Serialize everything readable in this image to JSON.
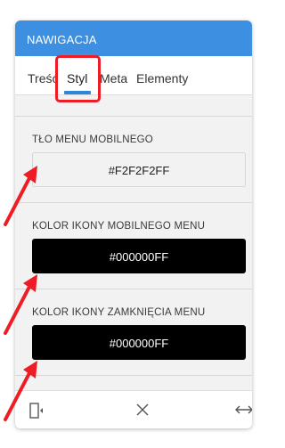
{
  "panel": {
    "title": "NAWIGACJA"
  },
  "tabs": [
    {
      "label": "Treść"
    },
    {
      "label": "Styl",
      "active": true
    },
    {
      "label": "Meta"
    },
    {
      "label": "Elementy"
    }
  ],
  "sections": [
    {
      "label": "TŁO MENU MOBILNEGO",
      "value": "#F2F2F2FF",
      "color": "#f2f2f2"
    },
    {
      "label": "KOLOR IKONY MOBILNEGO MENU",
      "value": "#000000FF",
      "color": "#000000"
    },
    {
      "label": "KOLOR IKONY ZAMKNIĘCIA MENU",
      "value": "#000000FF",
      "color": "#000000"
    }
  ],
  "footer": {
    "icons": [
      "mobile-preview-icon",
      "close-icon",
      "horizontal-resize-icon"
    ]
  },
  "colors": {
    "header": "#3d8fe2",
    "accent": "#2f86d9",
    "annotation": "#ee1c25",
    "panel_bg": "#f2f2f2"
  }
}
